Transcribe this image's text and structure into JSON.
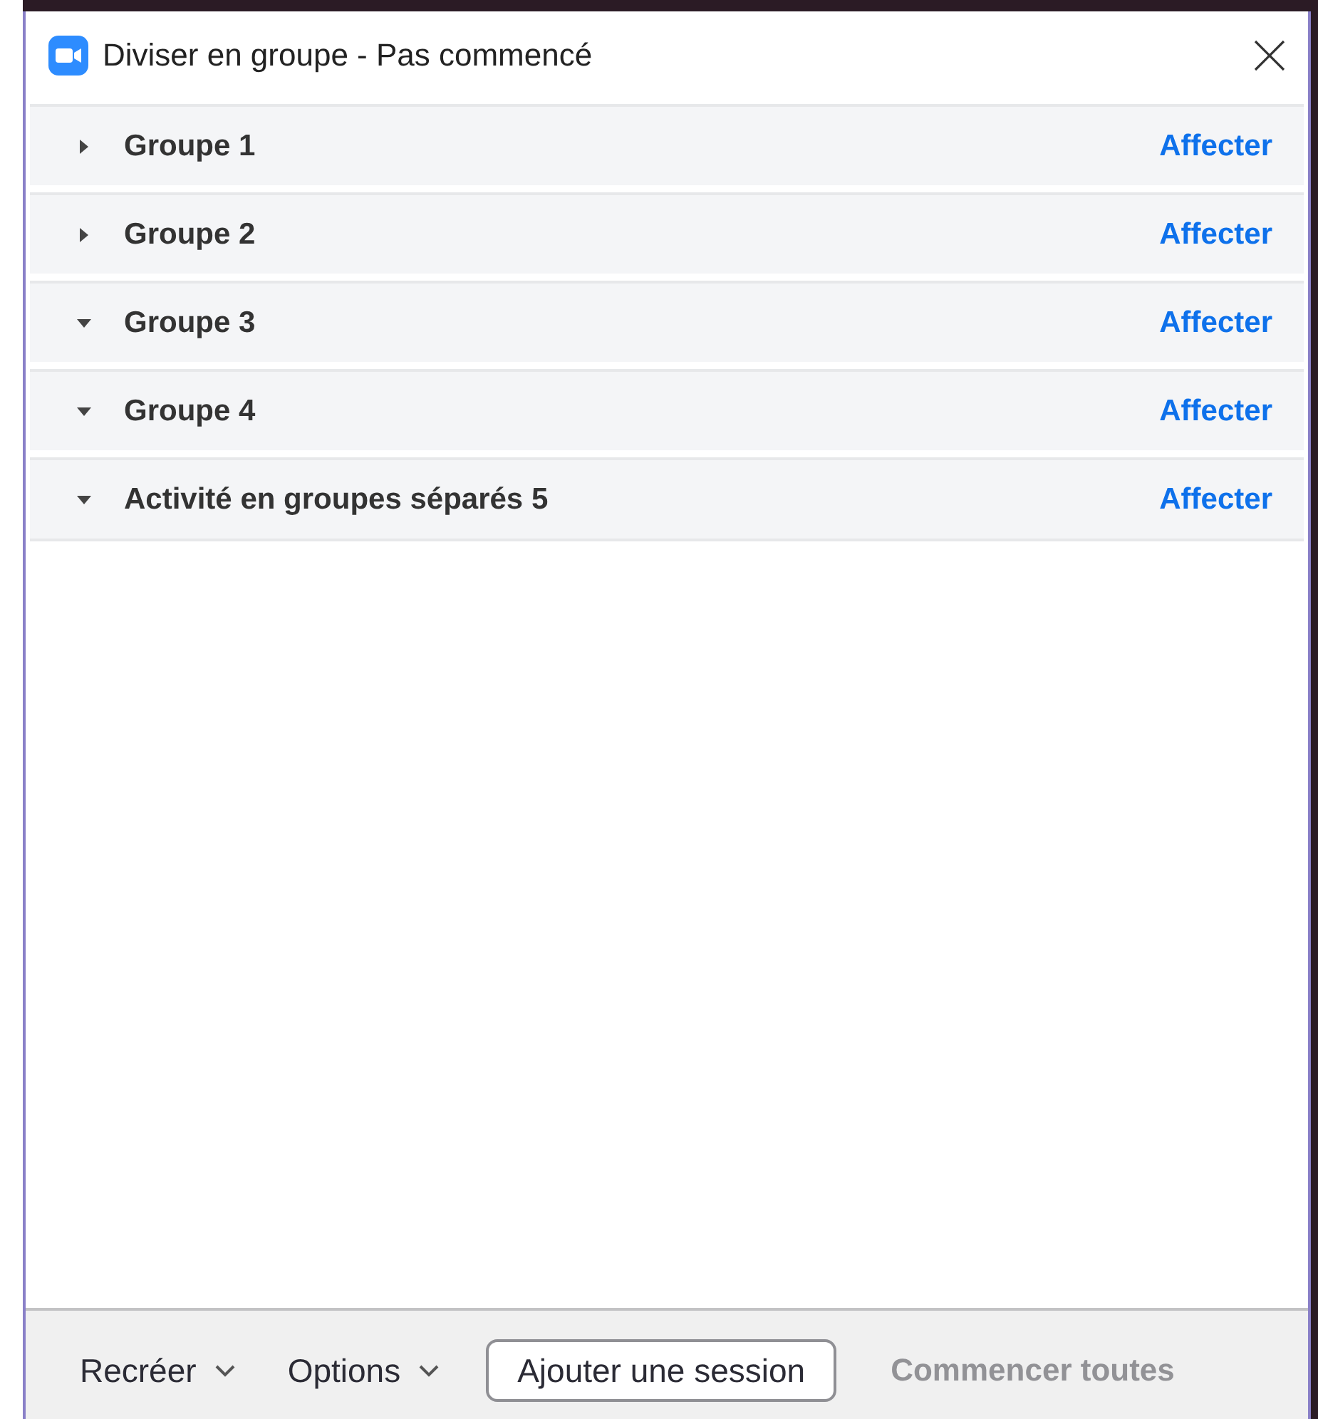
{
  "window": {
    "title": "Diviser en groupe - Pas commencé"
  },
  "groups": [
    {
      "name": "Groupe 1",
      "expanded": false,
      "action": "Affecter"
    },
    {
      "name": "Groupe 2",
      "expanded": false,
      "action": "Affecter"
    },
    {
      "name": "Groupe 3",
      "expanded": true,
      "action": "Affecter"
    },
    {
      "name": "Groupe 4",
      "expanded": true,
      "action": "Affecter"
    },
    {
      "name": "Activité en groupes séparés 5",
      "expanded": true,
      "action": "Affecter"
    }
  ],
  "footer": [
    {
      "kind": "dropdown",
      "label": "Recréer",
      "disabled": false
    },
    {
      "kind": "dropdown",
      "label": "Options",
      "disabled": false
    },
    {
      "kind": "outlined",
      "label": "Ajouter une session",
      "disabled": false
    },
    {
      "kind": "primary",
      "label": "Commencer toutes",
      "disabled": true
    }
  ]
}
